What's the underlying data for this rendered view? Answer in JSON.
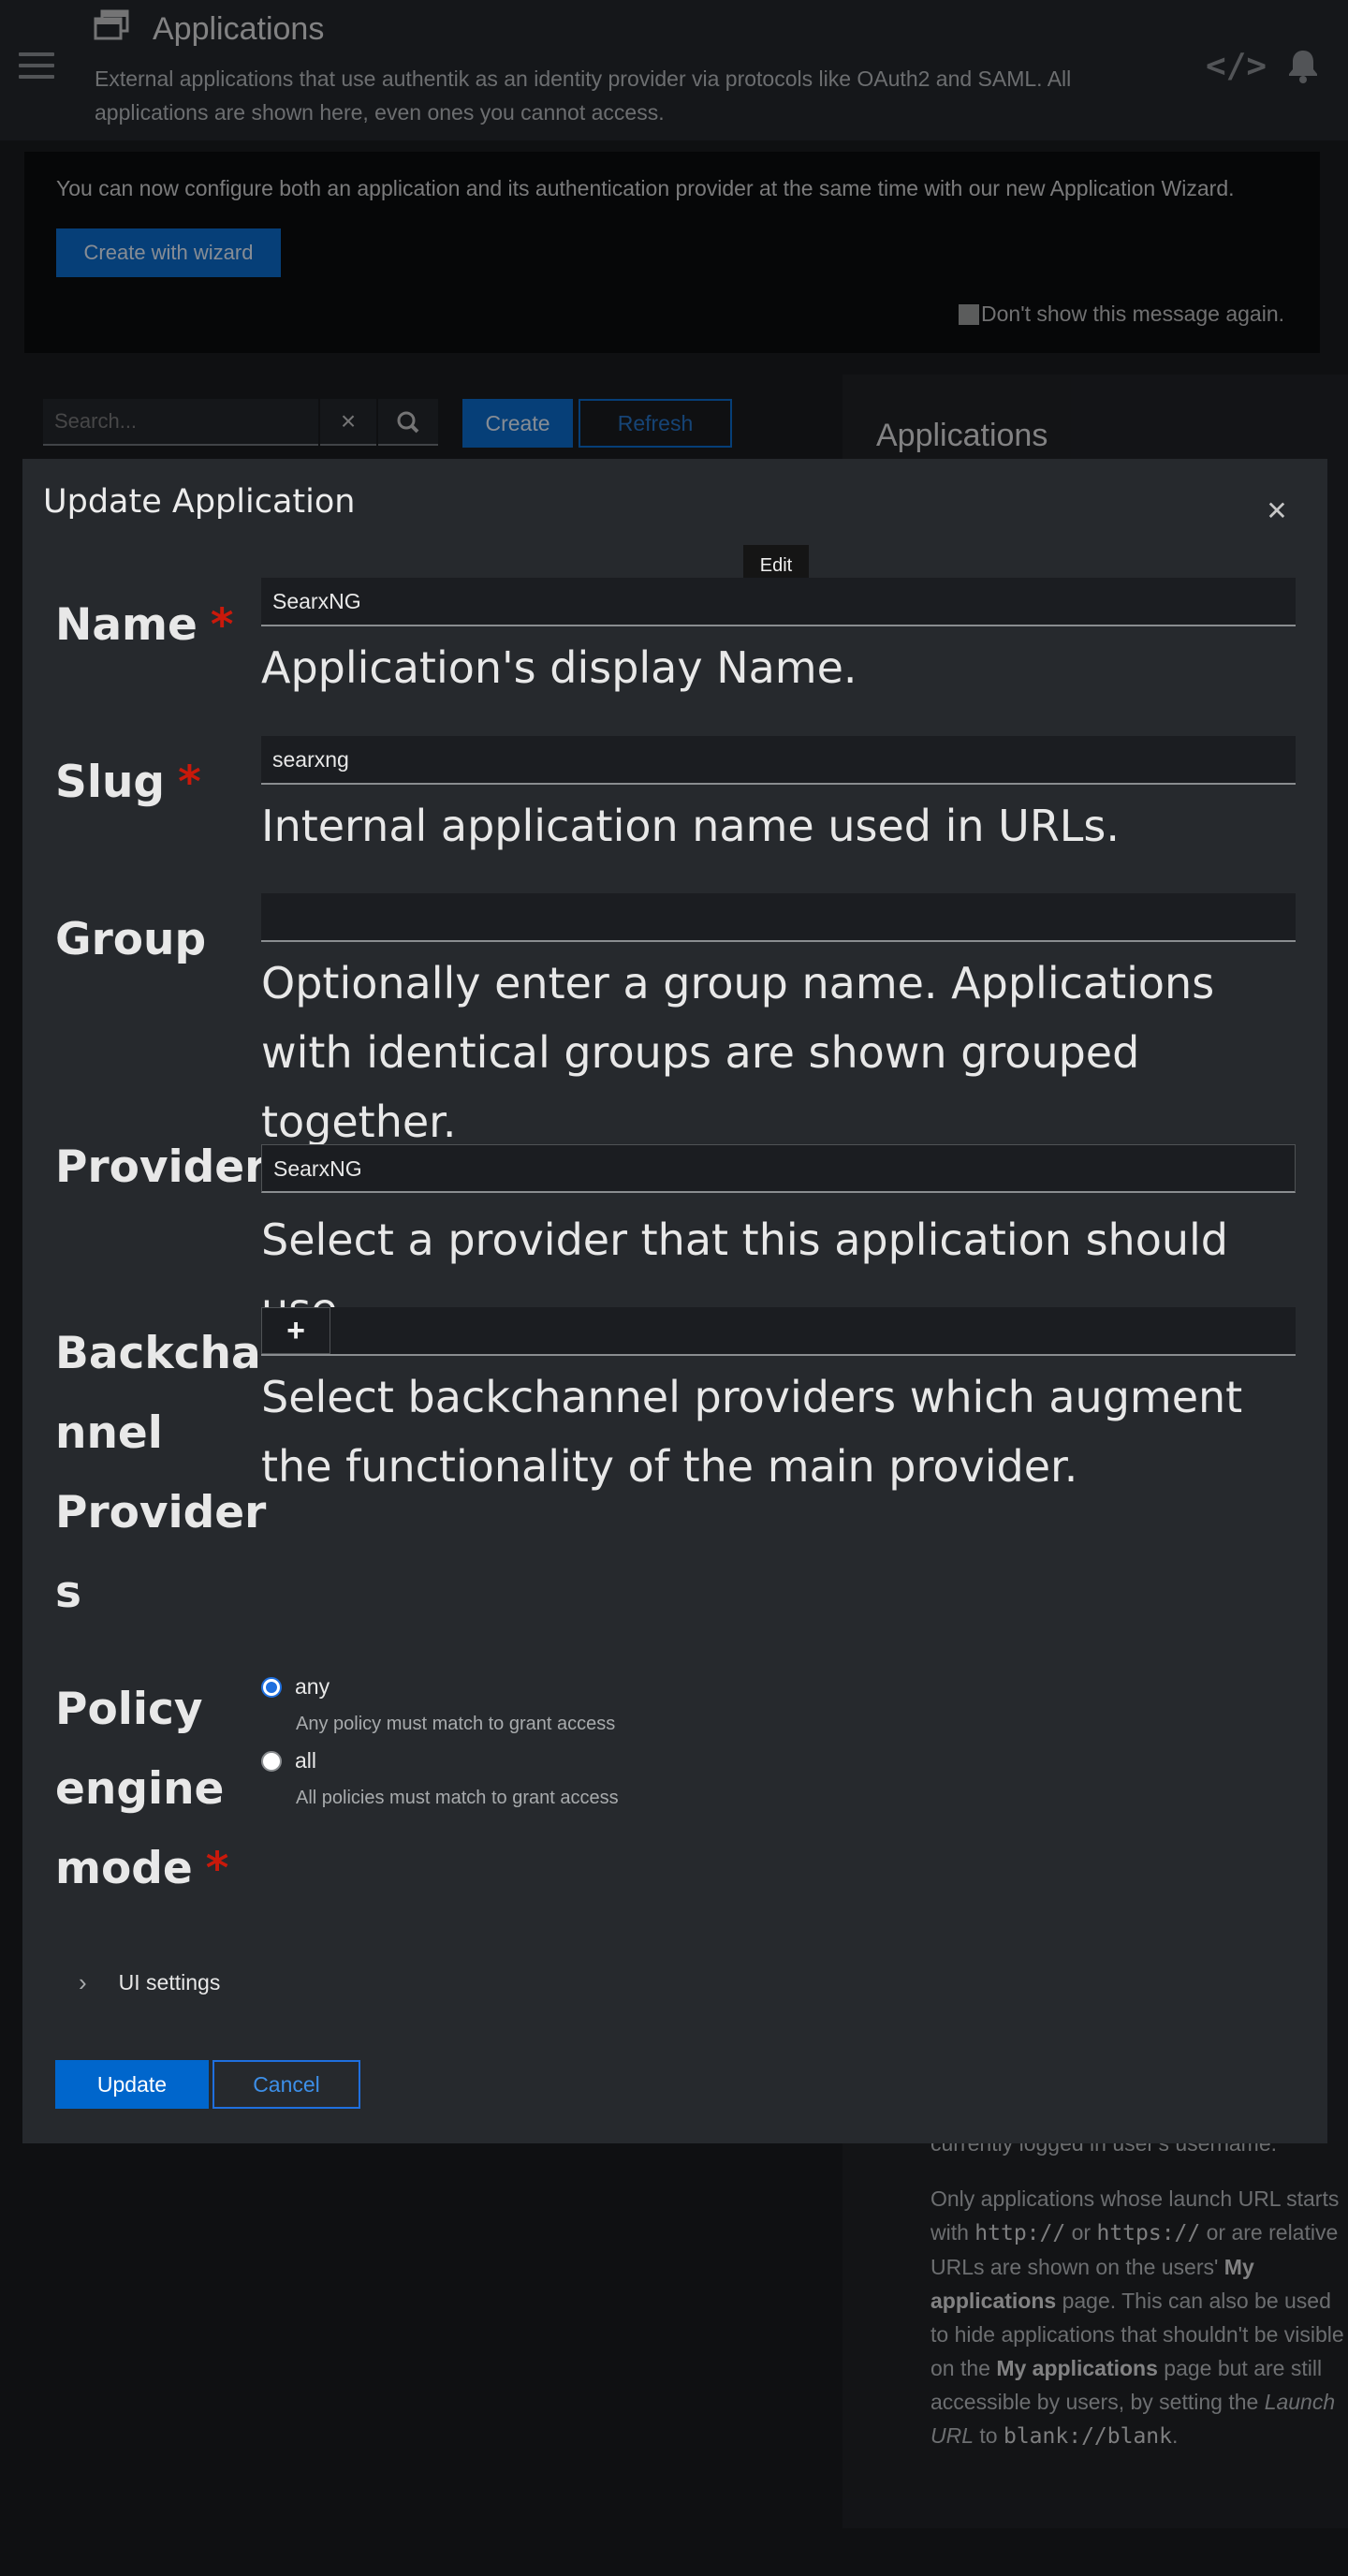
{
  "background": {
    "page_title": "Applications",
    "page_description": "External applications that use authentik as an identity provider via protocols like OAuth2 and SAML. All applications are shown here, even ones you cannot access.",
    "banner": {
      "text": "You can now configure both an application and its authentication provider at the same time with our new Application Wizard.",
      "wizard_button": "Create with wizard",
      "dont_show": "Don't show this message again."
    },
    "toolbar": {
      "search_placeholder": "Search...",
      "create_label": "Create",
      "refresh_label": "Refresh"
    },
    "side_panel": {
      "heading": "Applications",
      "fragment_1": "currently logged in user's username.",
      "para_1": "Only applications whose launch URL starts with",
      "code_http": "http://",
      "word_or": "or",
      "code_https": "https://",
      "para_2": "or are relative URLs are shown on the users'",
      "bold_my_apps": "My applications",
      "para_3": "page. This can also be used to hide applications that shouldn't be visible on the",
      "bold_my_apps_2": "My applications",
      "para_4": "page but are still accessible by users, by setting the",
      "italic_launch": "Launch URL",
      "word_to": "to",
      "code_blank": "blank://blank",
      "period": "."
    }
  },
  "modal": {
    "title": "Update Application",
    "tooltip": "Edit",
    "fields": {
      "name": {
        "label": "Name",
        "value": "SearxNG",
        "helper": "Application's display Name."
      },
      "slug": {
        "label": "Slug",
        "value": "searxng",
        "helper": "Internal application name used in URLs."
      },
      "group": {
        "label": "Group",
        "value": "",
        "helper": "Optionally enter a group name. Applications with identical groups are shown grouped together."
      },
      "provider": {
        "label": "Provider",
        "value": "SearxNG",
        "helper": "Select a provider that this application should use."
      },
      "backchannel": {
        "label_lines": [
          "Backcha",
          "nnel",
          "Provider",
          "s"
        ],
        "helper": "Select backchannel providers which augment the functionality of the main provider."
      },
      "policy": {
        "label_lines": [
          "Policy",
          "engine",
          "mode"
        ],
        "options": [
          {
            "label": "any",
            "description": "Any policy must match to grant access",
            "selected": true
          },
          {
            "label": "all",
            "description": "All policies must match to grant access",
            "selected": false
          }
        ]
      }
    },
    "ui_settings_label": "UI settings",
    "update_label": "Update",
    "cancel_label": "Cancel"
  }
}
